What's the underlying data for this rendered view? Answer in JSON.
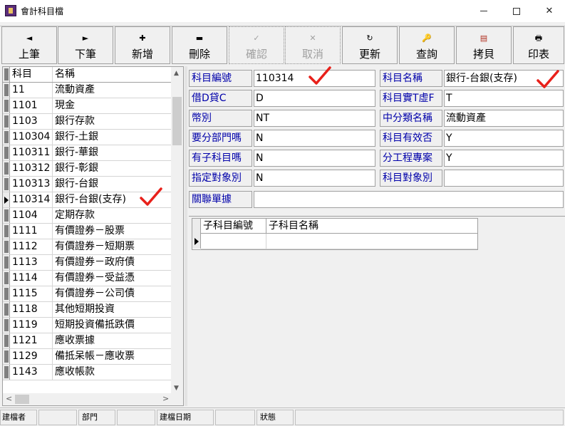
{
  "window": {
    "title": "會計科目檔",
    "min_glyph": "—",
    "max_glyph": "☐",
    "close_glyph": "✕"
  },
  "toolbar": {
    "buttons": [
      {
        "label": "上筆",
        "icon": "◄"
      },
      {
        "label": "下筆",
        "icon": "►"
      },
      {
        "label": "新增",
        "icon": "✚"
      },
      {
        "label": "刪除",
        "icon": "▬"
      },
      {
        "label": "確認",
        "icon": "✓"
      },
      {
        "label": "取消",
        "icon": "✕"
      },
      {
        "label": "更新",
        "icon": "↻"
      },
      {
        "label": "查詢",
        "icon": "🔑"
      },
      {
        "label": "拷貝",
        "icon": "▤"
      },
      {
        "label": "印表",
        "icon": "🖶"
      }
    ]
  },
  "account_list": {
    "headers": [
      "科目",
      "名稱"
    ],
    "rows": [
      {
        "code": "11",
        "name": "流動資產"
      },
      {
        "code": "1101",
        "name": "現金"
      },
      {
        "code": "1103",
        "name": "銀行存款"
      },
      {
        "code": "110304",
        "name": "銀行-土銀"
      },
      {
        "code": "110311",
        "name": "銀行-華銀"
      },
      {
        "code": "110312",
        "name": "銀行-彰銀"
      },
      {
        "code": "110313",
        "name": "銀行-台銀"
      },
      {
        "code": "110314",
        "name": "銀行-台銀(支存)"
      },
      {
        "code": "1104",
        "name": "定期存款"
      },
      {
        "code": "1111",
        "name": "有價證券－股票"
      },
      {
        "code": "1112",
        "name": "有價證券－短期票"
      },
      {
        "code": "1113",
        "name": "有價證券－政府債"
      },
      {
        "code": "1114",
        "name": "有價證券－受益憑"
      },
      {
        "code": "1115",
        "name": "有價證券－公司債"
      },
      {
        "code": "1118",
        "name": "其他短期投資"
      },
      {
        "code": "1119",
        "name": "短期投資備抵跌價"
      },
      {
        "code": "1121",
        "name": "應收票據"
      },
      {
        "code": "1129",
        "name": "備抵呆帳－應收票"
      },
      {
        "code": "1143",
        "name": "應收帳款"
      }
    ],
    "scroll_up": "▲",
    "scroll_down": "▼",
    "scroll_left": "<",
    "scroll_right": ">"
  },
  "form": {
    "account_no_label": "科目編號",
    "account_no": "110314",
    "account_name_label": "科目名稱",
    "account_name": "銀行-台銀(支存)",
    "dc_label": "借D貸C",
    "dc": "D",
    "tf_label": "科目實T虛F",
    "tf": "T",
    "currency_label": "幣別",
    "currency": "NT",
    "category_label": "中分類名稱",
    "category": "流動資產",
    "dept_label": "要分部門嗎",
    "dept": "N",
    "valid_label": "科目有效否",
    "valid": "Y",
    "subaccount_label": "有子科目嗎",
    "subaccount": "N",
    "project_label": "分工程專案",
    "project": "Y",
    "target_label": "指定對象別",
    "target": "N",
    "target_type_label": "科目對象別",
    "target_type": "",
    "related_label": "關聯單據",
    "related": ""
  },
  "subgrid": {
    "headers": [
      "子科目編號",
      "子科目名稱"
    ]
  },
  "statusbar": {
    "creator_label": "建檔者",
    "creator": "",
    "dept_label": "部門",
    "dept": "",
    "date_label": "建檔日期",
    "date": "",
    "status_label": "狀態",
    "status": ""
  },
  "colors": {
    "label_text": "#0000aa",
    "checkmark": "#e8201a"
  }
}
